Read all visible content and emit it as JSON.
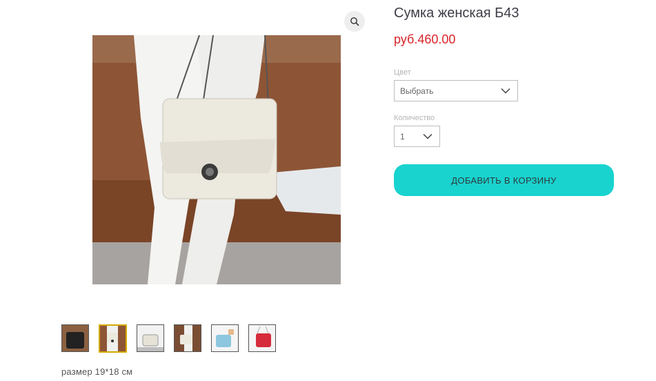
{
  "product": {
    "title": "Сумка женская Б43",
    "price": "руб.460.00",
    "description": "размер 19*18 см"
  },
  "options": {
    "color": {
      "label": "Цвет",
      "value": "Выбрать"
    },
    "quantity": {
      "label": "Количество",
      "value": "1"
    }
  },
  "actions": {
    "add_to_cart": "ДОБАВИТЬ В КОРЗИНУ"
  },
  "gallery": {
    "thumbnails": [
      {
        "name": "black-bag"
      },
      {
        "name": "white-bag-selected"
      },
      {
        "name": "white-bag-side"
      },
      {
        "name": "white-bag-detail"
      },
      {
        "name": "blue-bag"
      },
      {
        "name": "red-bag"
      }
    ]
  },
  "colors": {
    "accent": "#19d3cf",
    "price": "#d8232a",
    "thumb_selected": "#d4a900"
  },
  "icons": {
    "zoom": "magnifier-icon",
    "dropdown": "chevron-down-icon"
  }
}
